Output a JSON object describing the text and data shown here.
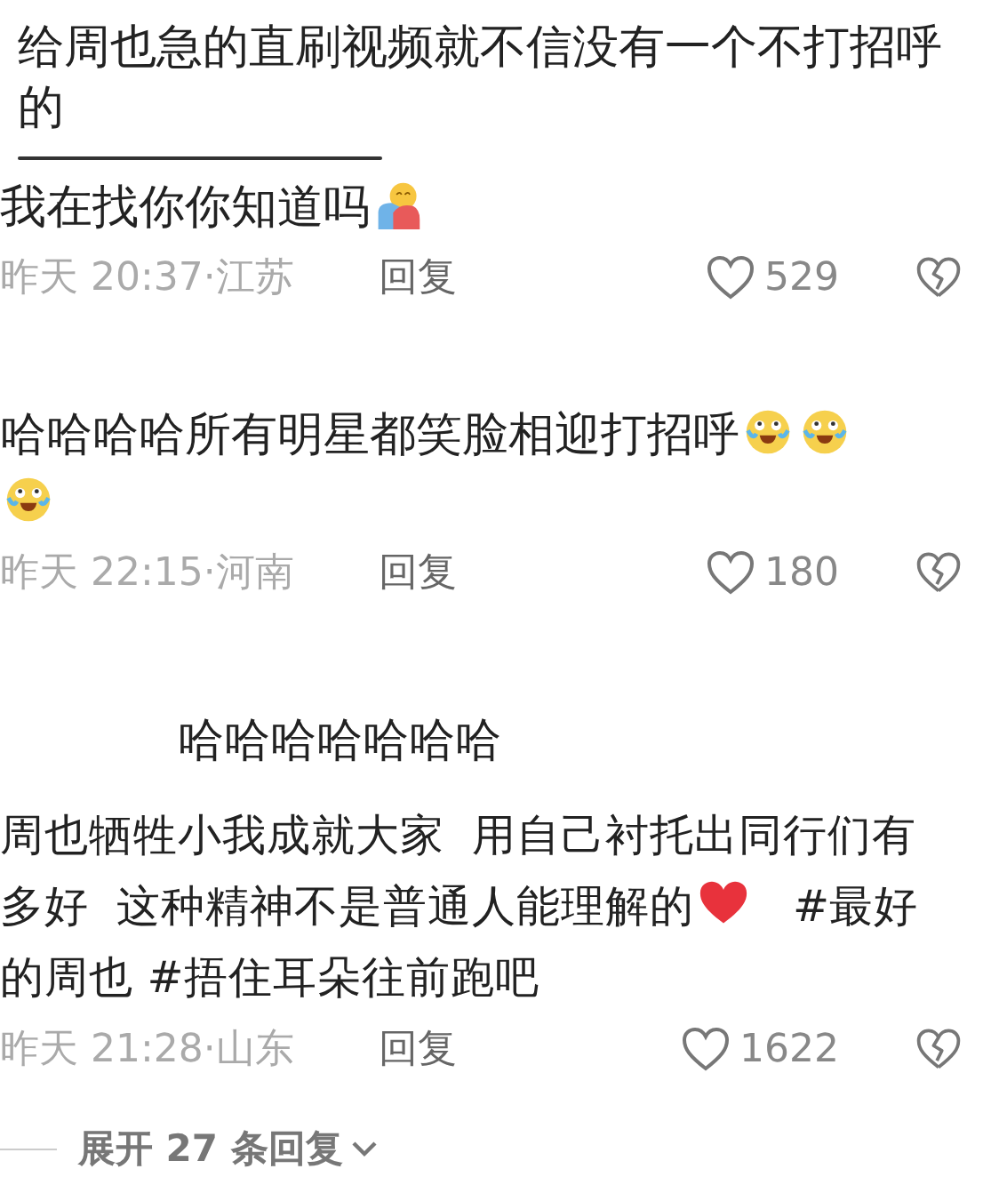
{
  "header_comment": {
    "text": "给周也急的直刷视频就不信没有一个不打招呼的"
  },
  "comments": [
    {
      "parts": [
        {
          "kind": "text",
          "text": "我在找你你知道吗"
        },
        {
          "kind": "hug"
        }
      ],
      "time": "昨天 20:37·江苏",
      "reply": "回复",
      "likes": "529"
    },
    {
      "parts": [
        {
          "kind": "text",
          "text": "哈哈哈哈所有明星都笑脸相迎打招呼"
        },
        {
          "kind": "laugh"
        },
        {
          "kind": "laugh"
        },
        {
          "kind": "laugh"
        }
      ],
      "time": "昨天 22:15·河南",
      "reply": "回复",
      "likes": "180"
    },
    {
      "parts": [
        {
          "kind": "text",
          "text": "哈哈哈哈哈哈哈"
        }
      ]
    },
    {
      "parts": [
        {
          "kind": "text",
          "text": "周也牺牲小我成就大家  用自己衬托出同行们有多好  这种精神不是普通人能理解的"
        },
        {
          "kind": "heart"
        },
        {
          "kind": "text",
          "text": "   #最好的周也 #捂住耳朵往前跑吧"
        }
      ],
      "time": "昨天 21:28·山东",
      "reply": "回复",
      "likes": "1622"
    }
  ],
  "expand": {
    "label": "展开 27 条回复"
  }
}
